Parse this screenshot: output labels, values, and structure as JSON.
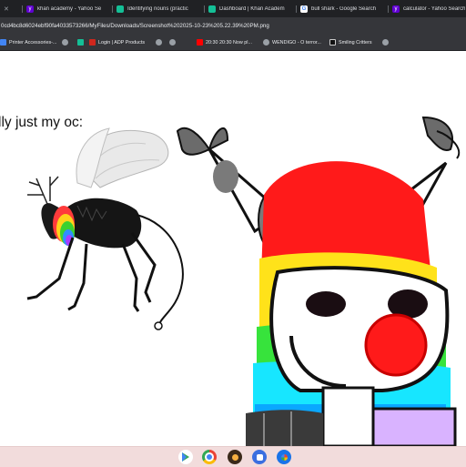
{
  "tabs": [
    {
      "label": "",
      "fav": "purple",
      "favicon": "yahoo-icon"
    },
    {
      "label": "khan academy - Yahoo Se",
      "fav": "#6001d2",
      "favicon": "yahoo-icon"
    },
    {
      "label": "Identifying nouns (practic",
      "fav": "#14bf96",
      "favicon": "khan-academy-icon"
    },
    {
      "label": "Dashboard | Khan Academ",
      "fav": "#14bf96",
      "favicon": "khan-academy-icon"
    },
    {
      "label": "bull shark - Google Search",
      "fav": "#ffffff",
      "favicon": "google-icon"
    },
    {
      "label": "calculator - Yahoo Search",
      "fav": "#6001d2",
      "favicon": "yahoo-icon"
    }
  ],
  "url": "0cd4bc8d6024ebf90fa4033573266/MyFiles/Downloads/Screenshot%202025-10-23%205.22.39%20PM.png",
  "bookmarks": [
    {
      "label": "Printer Accessories-...",
      "icon": "printer-icon"
    },
    {
      "label": "",
      "icon": "globe-icon"
    },
    {
      "label": "",
      "icon": "khan-academy-icon"
    },
    {
      "label": "Login | ADP Products",
      "icon": "adp-icon"
    },
    {
      "label": "",
      "icon": "globe-icon"
    },
    {
      "label": "",
      "icon": "globe-icon"
    },
    {
      "label": "20:30 20:30 Now pl...",
      "icon": "youtube-icon"
    },
    {
      "label": "WENDIGO - O terror...",
      "icon": "globe-icon"
    },
    {
      "label": "Smiling Critters",
      "icon": "pinterest-icon"
    },
    {
      "label": "",
      "icon": "globe-icon"
    }
  ],
  "page": {
    "caption": "lly just my oc:"
  },
  "taskbar": [
    {
      "name": "play-store-icon"
    },
    {
      "name": "chrome-icon"
    },
    {
      "name": "app-icon"
    },
    {
      "name": "files-icon"
    },
    {
      "name": "photos-icon"
    }
  ],
  "colors": {
    "tabbar": "#202124",
    "toolbar": "#35363a",
    "taskbar": "#f2dcdc"
  }
}
